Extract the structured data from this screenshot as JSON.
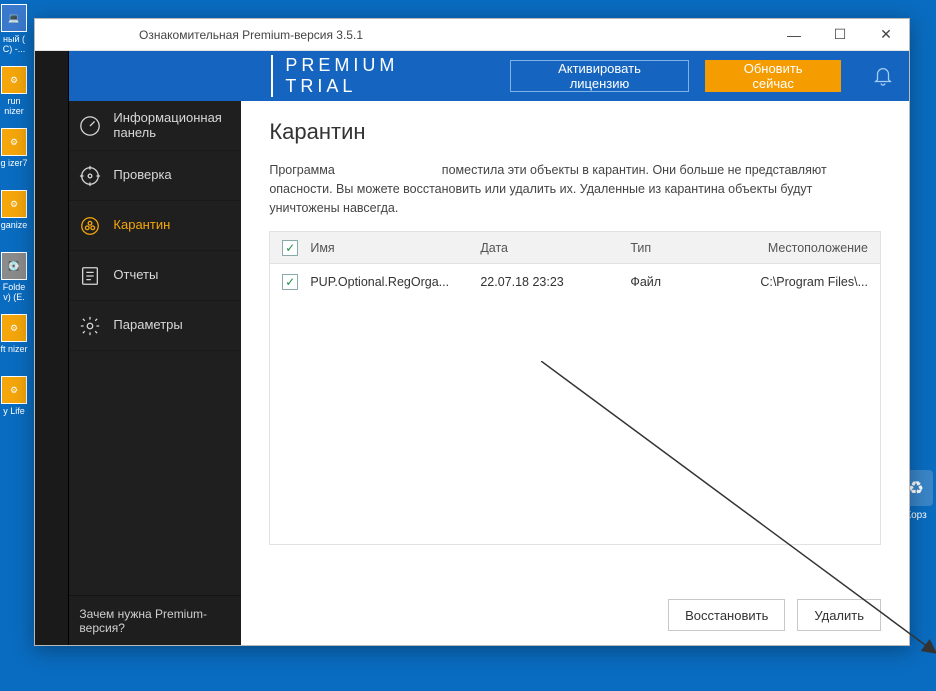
{
  "desktop": {
    "icons": [
      "ный (\nС) -...",
      "run\nnizer",
      "g\nizer7",
      "ganize",
      "Folde\nv) (E.",
      "ft\nnizer",
      "y Life"
    ],
    "recycle": "Корз"
  },
  "window": {
    "title": "Ознакомительная Premium-версия 3.5.1",
    "btns": {
      "min": "—",
      "max": "☐",
      "close": "✕"
    }
  },
  "topbar": {
    "title": "PREMIUM TRIAL",
    "activate": "Активировать лицензию",
    "update": "Обновить сейчас"
  },
  "sidebar": {
    "items": [
      {
        "label": "Информационная панель",
        "icon": "gauge",
        "active": false
      },
      {
        "label": "Проверка",
        "icon": "target",
        "active": false
      },
      {
        "label": "Карантин",
        "icon": "biohazard",
        "active": true
      },
      {
        "label": "Отчеты",
        "icon": "report",
        "active": false
      },
      {
        "label": "Параметры",
        "icon": "gear",
        "active": false
      }
    ],
    "footer": "Зачем нужна Premium-версия?"
  },
  "page": {
    "heading": "Карантин",
    "descr_pre": "Программа",
    "descr_post": "поместила эти объекты в карантин. Они больше не представляют опасности. Вы можете восстановить или удалить их. Удаленные из карантина объекты будут уничтожены навсегда.",
    "columns": {
      "name": "Имя",
      "date": "Дата",
      "type": "Тип",
      "location": "Местоположение"
    },
    "rows": [
      {
        "checked": true,
        "name": "PUP.Optional.RegOrga...",
        "date": "22.07.18 23:23",
        "type": "Файл",
        "location": "C:\\Program Files\\..."
      }
    ],
    "actions": {
      "restore": "Восстановить",
      "delete": "Удалить"
    }
  }
}
